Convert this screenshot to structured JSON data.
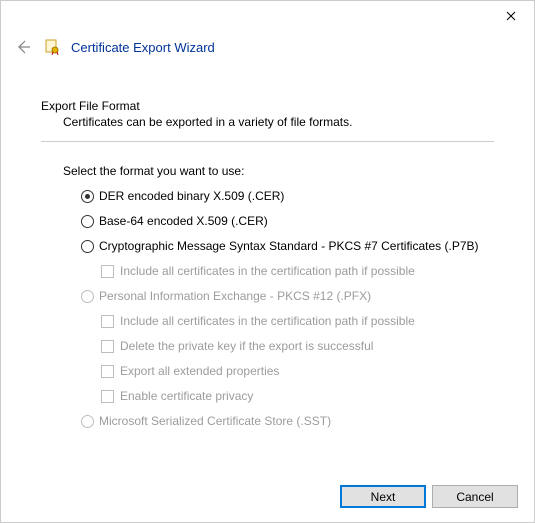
{
  "window": {
    "title": "Certificate Export Wizard"
  },
  "page": {
    "heading": "Export File Format",
    "description": "Certificates can be exported in a variety of file formats.",
    "prompt": "Select the format you want to use:"
  },
  "options": {
    "der": {
      "label": "DER encoded binary X.509 (.CER)",
      "checked": true,
      "enabled": true
    },
    "b64": {
      "label": "Base-64 encoded X.509 (.CER)",
      "checked": false,
      "enabled": true
    },
    "pkcs7": {
      "label": "Cryptographic Message Syntax Standard - PKCS #7 Certificates (.P7B)",
      "checked": false,
      "enabled": true
    },
    "pkcs7_include_chain": {
      "label": "Include all certificates in the certification path if possible",
      "checked": false,
      "enabled": false
    },
    "pfx": {
      "label": "Personal Information Exchange - PKCS #12 (.PFX)",
      "checked": false,
      "enabled": false
    },
    "pfx_include_chain": {
      "label": "Include all certificates in the certification path if possible",
      "checked": false,
      "enabled": false
    },
    "pfx_delete_key": {
      "label": "Delete the private key if the export is successful",
      "checked": false,
      "enabled": false
    },
    "pfx_export_ext": {
      "label": "Export all extended properties",
      "checked": false,
      "enabled": false
    },
    "pfx_cert_privacy": {
      "label": "Enable certificate privacy",
      "checked": false,
      "enabled": false
    },
    "sst": {
      "label": "Microsoft Serialized Certificate Store (.SST)",
      "checked": false,
      "enabled": false
    }
  },
  "buttons": {
    "next": "Next",
    "cancel": "Cancel"
  }
}
